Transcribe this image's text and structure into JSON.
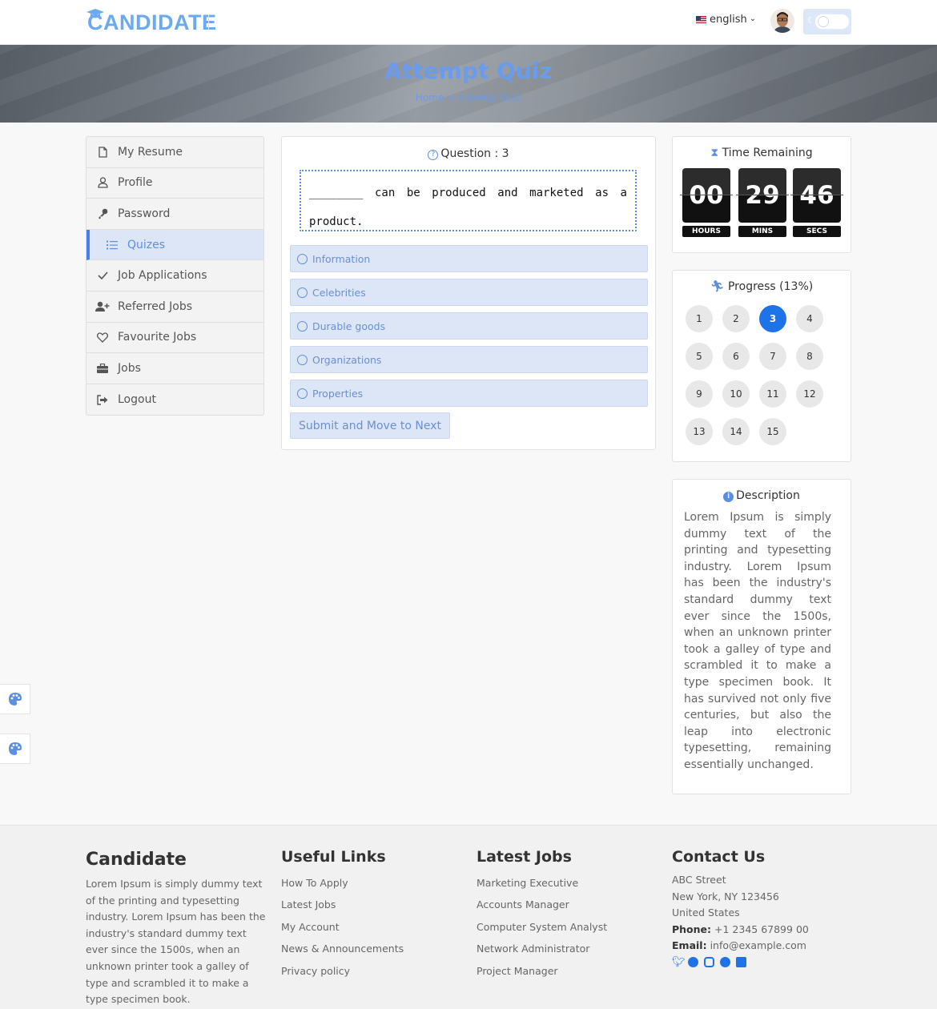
{
  "header": {
    "logo_text": "CANDIDATE",
    "language": "english",
    "icons": {
      "logo": "graduation-cap-icon",
      "flag": "us-flag-icon",
      "theme": "moon-icon"
    }
  },
  "hero": {
    "title": "Attempt Quiz",
    "breadcrumb": {
      "home": "Home",
      "separator": ">",
      "current": "Attempt Quiz"
    }
  },
  "sidebar": {
    "items": [
      {
        "label": "My Resume",
        "icon": "file-icon",
        "active": false
      },
      {
        "label": "Profile",
        "icon": "user-icon",
        "active": false
      },
      {
        "label": "Password",
        "icon": "key-icon",
        "active": false
      },
      {
        "label": "Quizes",
        "icon": "list-icon",
        "active": true
      },
      {
        "label": "Job Applications",
        "icon": "check-icon",
        "active": false
      },
      {
        "label": "Referred Jobs",
        "icon": "user-plus-icon",
        "active": false
      },
      {
        "label": "Favourite Jobs",
        "icon": "heart-icon",
        "active": false
      },
      {
        "label": "Jobs",
        "icon": "briefcase-icon",
        "active": false
      },
      {
        "label": "Logout",
        "icon": "sign-out-icon",
        "active": false
      }
    ]
  },
  "quiz": {
    "question_label": "Question : 3",
    "question_text": "________ can be produced and marketed as a product.",
    "options": [
      "Information",
      "Celebrities",
      "Durable goods",
      "Organizations",
      "Properties"
    ],
    "submit_label": "Submit and Move to Next"
  },
  "timer": {
    "title": "Time Remaining",
    "hours": "00",
    "mins": "29",
    "secs": "46",
    "hours_label": "HOURS",
    "mins_label": "MINS",
    "secs_label": "SECS"
  },
  "progress": {
    "title": "Progress (13%)",
    "percent": 13,
    "current": 3,
    "questions": [
      "1",
      "2",
      "3",
      "4",
      "5",
      "6",
      "7",
      "8",
      "9",
      "10",
      "11",
      "12",
      "13",
      "14",
      "15"
    ]
  },
  "description": {
    "title": "Description",
    "text": "Lorem Ipsum is simply dummy text of the printing and typesetting industry. Lorem Ipsum has been the industry's standard dummy text ever since the 1500s, when an unknown printer took a galley of type and scrambled it to make a type specimen book. It has survived not only five centuries, but also the leap into electronic typesetting, remaining essentially unchanged."
  },
  "footer": {
    "about_title": "Candidate",
    "about_text": "Lorem Ipsum is simply dummy text of the printing and typesetting industry. Lorem Ipsum has been the industry's standard dummy text ever since the 1500s, when an unknown printer took a galley of type and scrambled it to make a type specimen book.",
    "useful_title": "Useful Links",
    "useful_links": [
      "How To Apply",
      "Latest Jobs",
      "My Account",
      "News & Announcements",
      "Privacy policy"
    ],
    "jobs_title": "Latest Jobs",
    "jobs_links": [
      "Marketing Executive",
      "Accounts Manager",
      "Computer System Analyst",
      "Network Administrator",
      "Project Manager"
    ],
    "contact_title": "Contact Us",
    "address_1": "ABC Street",
    "address_2": "New York, NY 123456",
    "address_3": "United States",
    "phone_label": "Phone:",
    "phone": "+1 2345 67899 00",
    "email_label": "Email:",
    "email": "info@example.com",
    "socials": [
      "twitter-icon",
      "facebook-icon",
      "instagram-icon",
      "google-plus-icon",
      "linkedin-icon"
    ]
  },
  "colors": {
    "accent": "#5d8fe0",
    "primary": "#1e73e8",
    "option_bg": "#dce6f7"
  }
}
